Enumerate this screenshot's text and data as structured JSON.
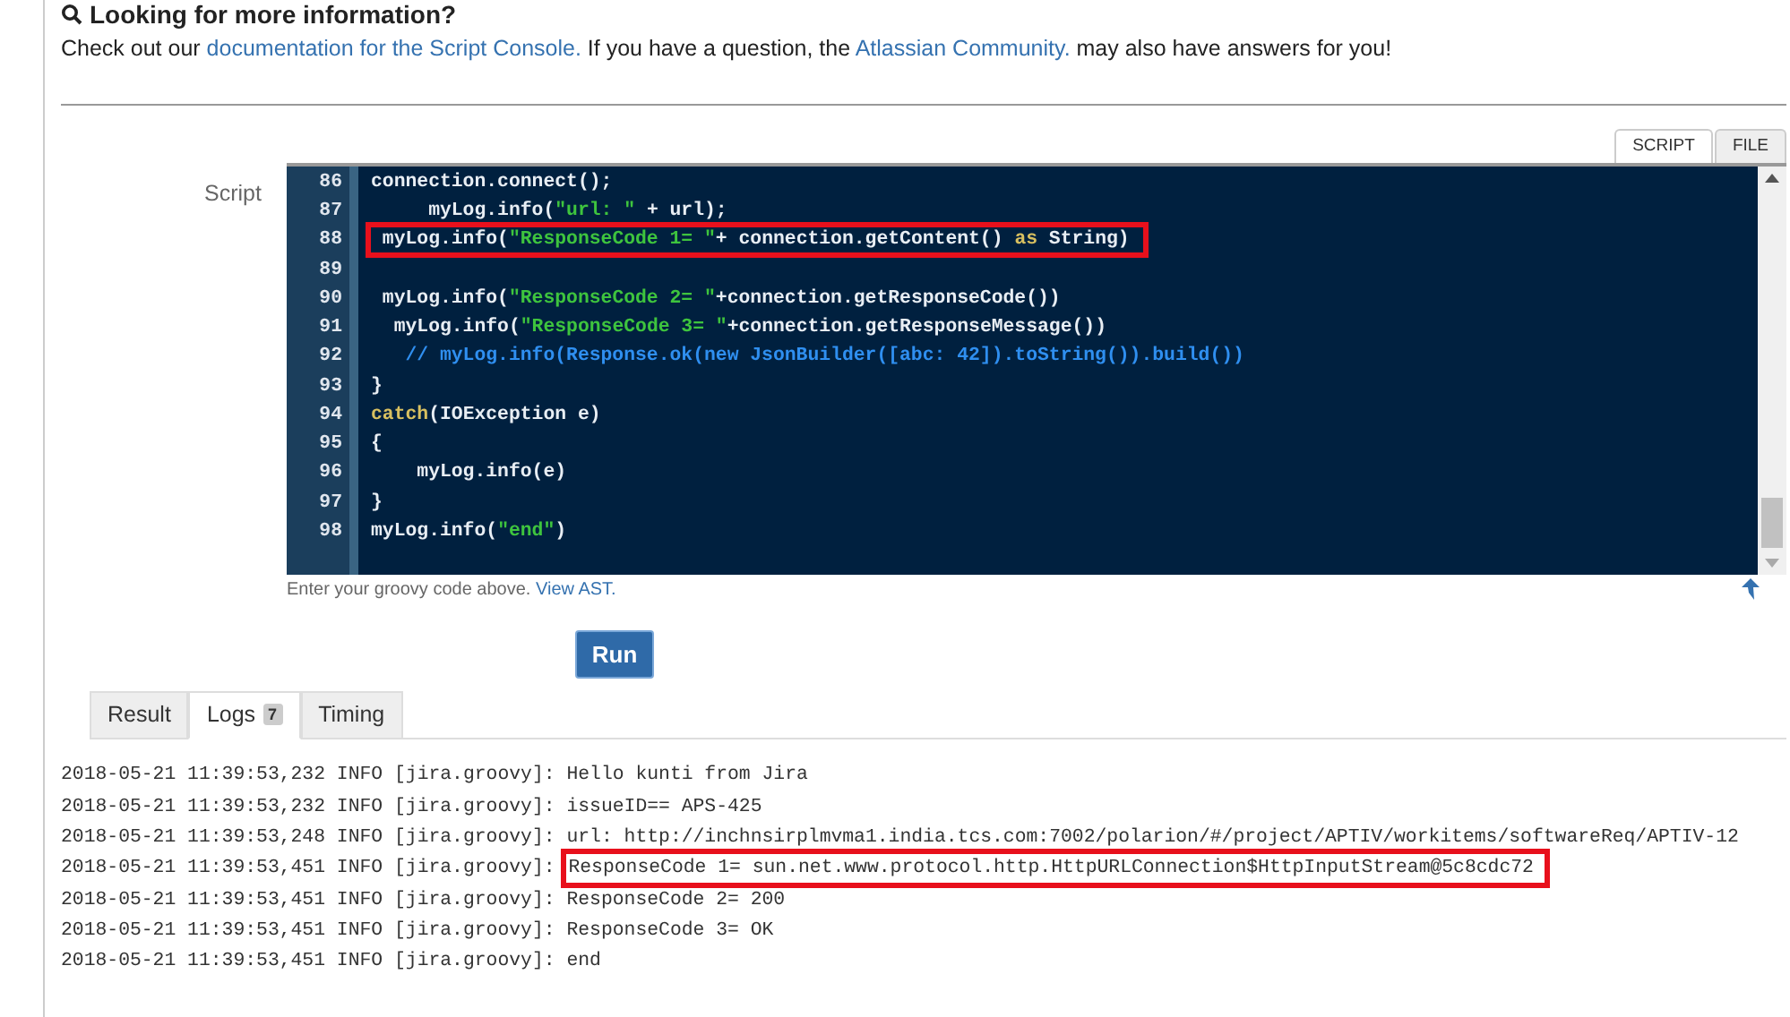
{
  "help": {
    "heading": "Looking for more information?",
    "text_parts": [
      {
        "kind": "text",
        "text": "Check out our "
      },
      {
        "kind": "link",
        "text": "documentation for the Script Console."
      },
      {
        "kind": "text",
        "text": " If you have a question, the "
      },
      {
        "kind": "link",
        "text": "Atlassian Community."
      },
      {
        "kind": "text",
        "text": " may also have answers for you!"
      }
    ]
  },
  "editor_tabs": [
    {
      "label": "SCRIPT",
      "selected": true
    },
    {
      "label": "FILE",
      "selected": false
    }
  ],
  "script_label": "Script",
  "code_lines": [
    {
      "number": "86",
      "highlighted": false,
      "tokens": [
        {
          "kind": "plain",
          "text": "connection.connect();"
        }
      ]
    },
    {
      "number": "87",
      "highlighted": false,
      "tokens": [
        {
          "kind": "plain",
          "text": "     myLog.info("
        },
        {
          "kind": "string",
          "text": "\"url: \""
        },
        {
          "kind": "plain",
          "text": " + url);"
        }
      ]
    },
    {
      "number": "88",
      "highlighted": true,
      "tokens": [
        {
          "kind": "plain",
          "text": " myLog.info("
        },
        {
          "kind": "string",
          "text": "\"ResponseCode 1= \""
        },
        {
          "kind": "plain",
          "text": "+ connection.getContent() "
        },
        {
          "kind": "keyword",
          "text": "as"
        },
        {
          "kind": "plain",
          "text": " String)"
        }
      ]
    },
    {
      "number": "89"
    },
    {
      "number": "90",
      "highlighted": false,
      "tokens": [
        {
          "kind": "plain",
          "text": " myLog.info("
        },
        {
          "kind": "string",
          "text": "\"ResponseCode 2= \""
        },
        {
          "kind": "plain",
          "text": "+connection.getResponseCode())"
        }
      ]
    },
    {
      "number": "91",
      "highlighted": false,
      "tokens": [
        {
          "kind": "plain",
          "text": "  myLog.info("
        },
        {
          "kind": "string",
          "text": "\"ResponseCode 3= \""
        },
        {
          "kind": "plain",
          "text": "+connection.getResponseMessage())"
        }
      ]
    },
    {
      "number": "92",
      "highlighted": false,
      "tokens": [
        {
          "kind": "comment",
          "text": "   // myLog.info(Response.ok(new JsonBuilder([abc: 42]).toString()).build())"
        }
      ]
    },
    {
      "number": "93",
      "highlighted": false,
      "tokens": [
        {
          "kind": "plain",
          "text": "}"
        }
      ]
    },
    {
      "number": "94",
      "highlighted": false,
      "tokens": [
        {
          "kind": "keyword",
          "text": "catch"
        },
        {
          "kind": "plain",
          "text": "(IOException e)"
        }
      ]
    },
    {
      "number": "95",
      "highlighted": false,
      "tokens": [
        {
          "kind": "plain",
          "text": "{"
        }
      ]
    },
    {
      "number": "96",
      "highlighted": false,
      "tokens": [
        {
          "kind": "plain",
          "text": "    myLog.info(e)"
        }
      ]
    },
    {
      "number": "97",
      "highlighted": false,
      "tokens": [
        {
          "kind": "plain",
          "text": "}"
        }
      ]
    },
    {
      "number": "98",
      "highlighted": false,
      "tokens": [
        {
          "kind": "plain",
          "text": "myLog.info("
        },
        {
          "kind": "string",
          "text": "\"end\""
        },
        {
          "kind": "plain",
          "text": ")"
        }
      ]
    }
  ],
  "editor_hint": {
    "text": "Enter your groovy code above.",
    "link": "View AST."
  },
  "run_button": "Run",
  "result_tabs": [
    {
      "label": "Result",
      "selected": false
    },
    {
      "label": "Logs",
      "badge": "7",
      "selected": true
    },
    {
      "label": "Timing",
      "selected": false
    }
  ],
  "log_lines": [
    {
      "prefix": "2018-05-21 11:39:53,232 INFO [jira.groovy]:",
      "message": "Hello kunti from Jira",
      "highlighted": false
    },
    {
      "prefix": "2018-05-21 11:39:53,232 INFO [jira.groovy]:",
      "message": "issueID== APS-425",
      "highlighted": false
    },
    {
      "prefix": "2018-05-21 11:39:53,248 INFO [jira.groovy]:",
      "message": "url: http://inchnsirplmvma1.india.tcs.com:7002/polarion/#/project/APTIV/workitems/softwareReq/APTIV-12",
      "highlighted": false
    },
    {
      "prefix": "2018-05-21 11:39:53,451 INFO [jira.groovy]:",
      "message": "ResponseCode 1= sun.net.www.protocol.http.HttpURLConnection$HttpInputStream@5c8cdc72",
      "highlighted": true
    },
    {
      "prefix": "2018-05-21 11:39:53,451 INFO [jira.groovy]:",
      "message": "ResponseCode 2= 200",
      "highlighted": false
    },
    {
      "prefix": "2018-05-21 11:39:53,451 INFO [jira.groovy]:",
      "message": "ResponseCode 3= OK",
      "highlighted": false
    },
    {
      "prefix": "2018-05-21 11:39:53,451 INFO [jira.groovy]:",
      "message": "end",
      "highlighted": false
    }
  ]
}
